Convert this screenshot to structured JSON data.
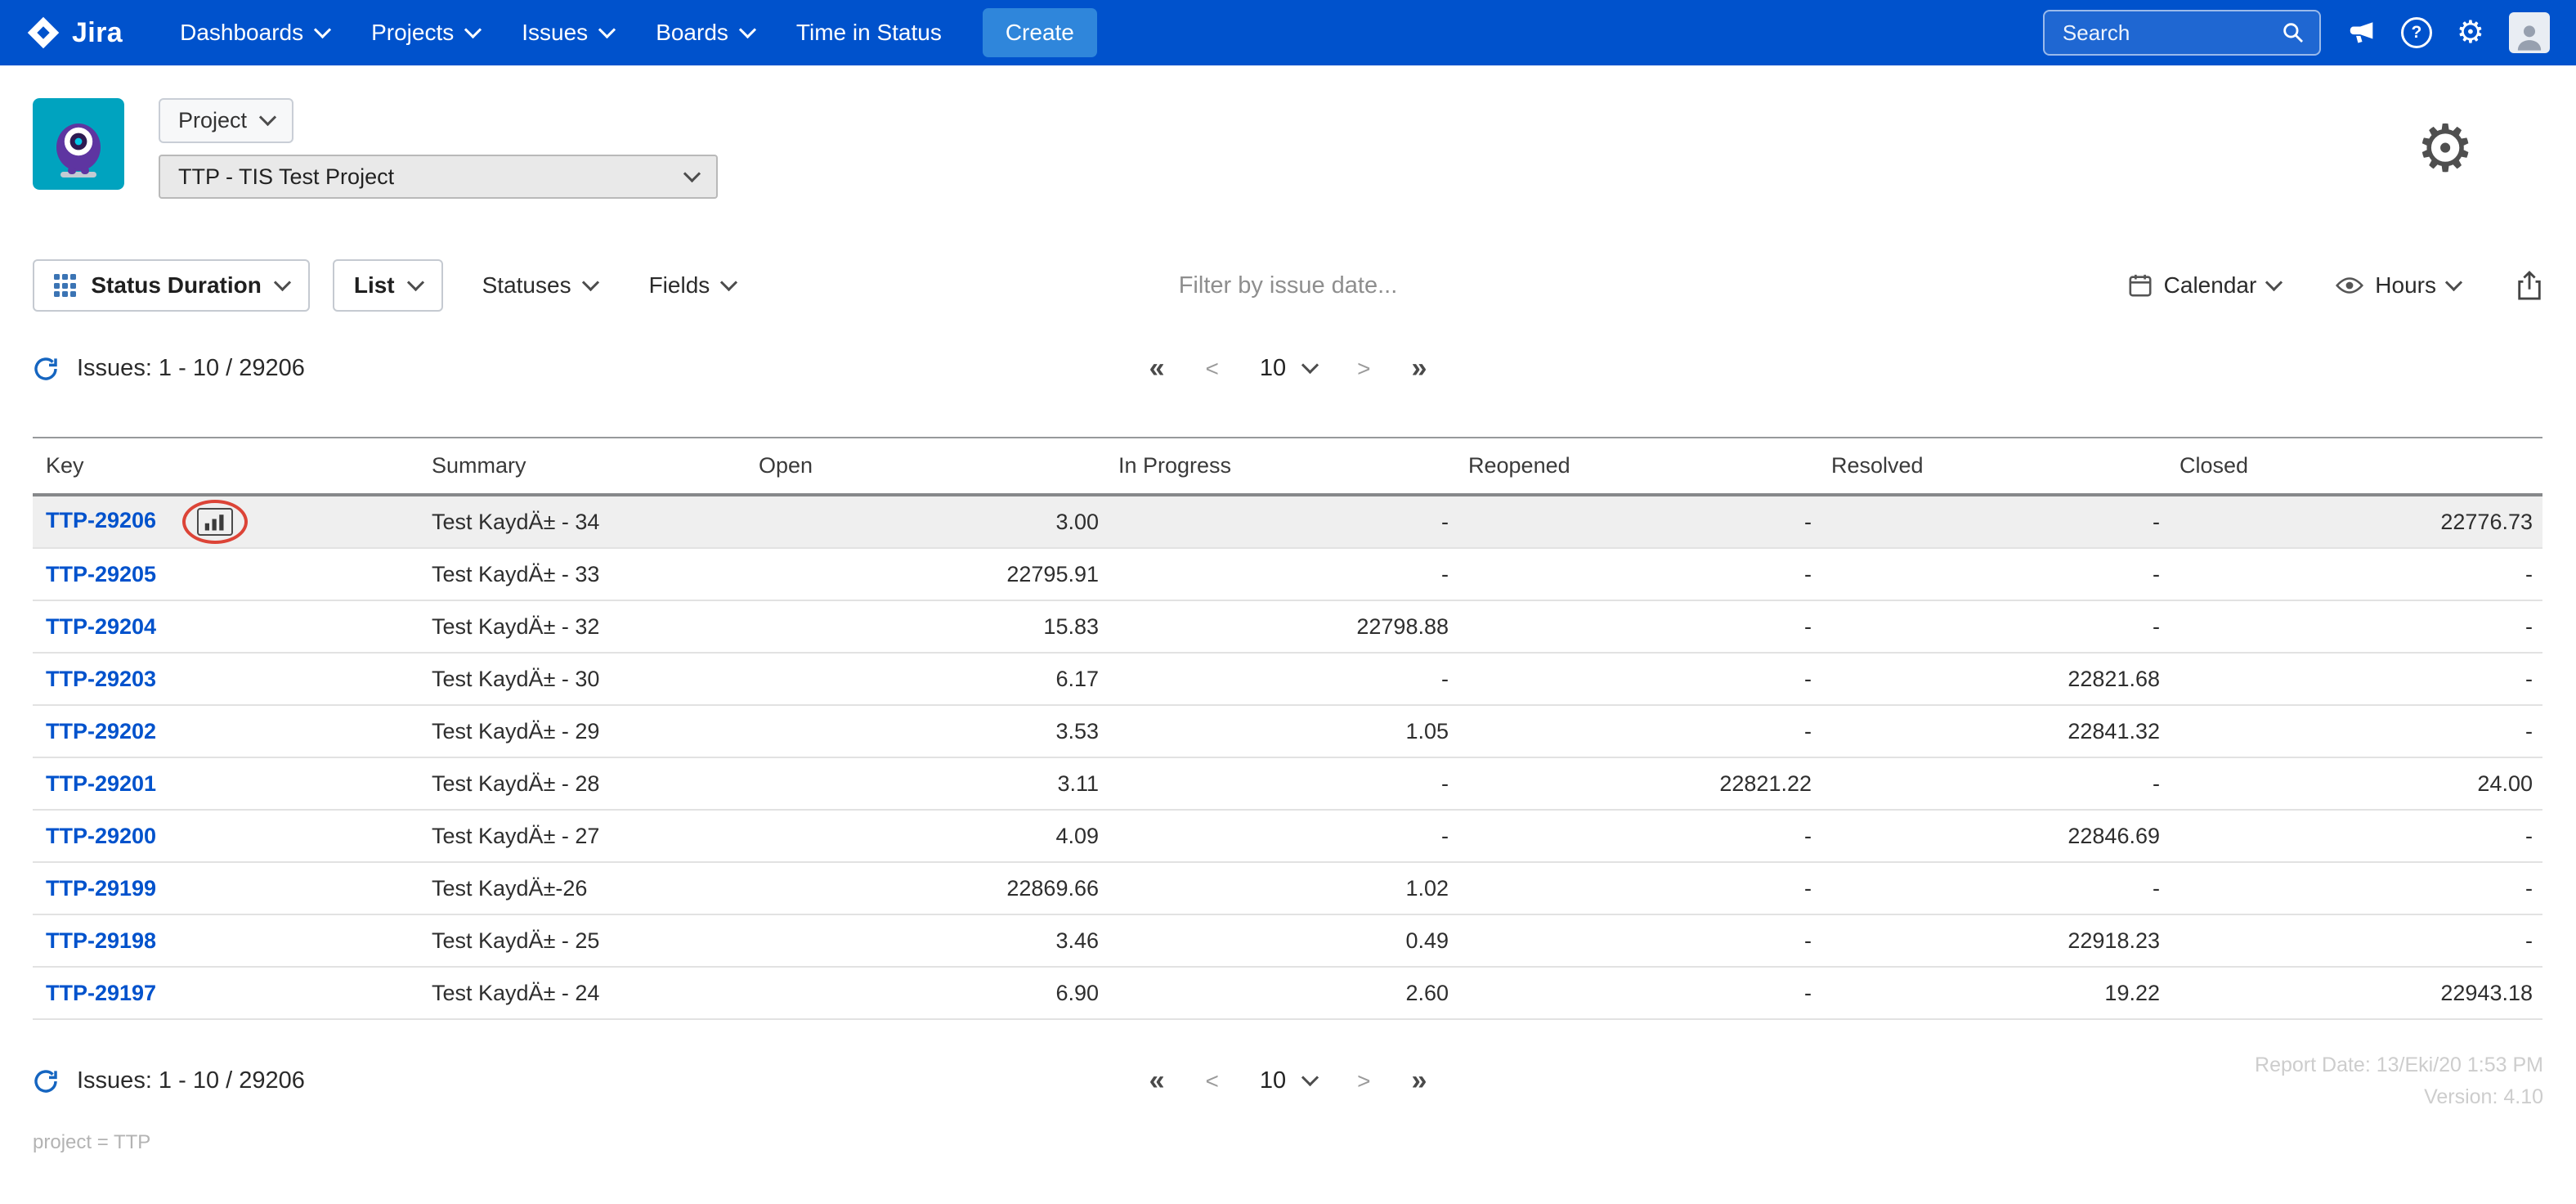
{
  "navbar": {
    "brand": "Jira",
    "items": [
      {
        "label": "Dashboards"
      },
      {
        "label": "Projects"
      },
      {
        "label": "Issues"
      },
      {
        "label": "Boards"
      },
      {
        "label": "Time in Status"
      }
    ],
    "create_label": "Create",
    "search_placeholder": "Search"
  },
  "icons": {
    "gear": "⚙",
    "help": "?"
  },
  "project_header": {
    "project_button_label": "Project",
    "project_name": "TTP - TIS Test Project"
  },
  "toolbar": {
    "report_type": "Status Duration",
    "view": "List",
    "statuses": "Statuses",
    "fields": "Fields",
    "filter_placeholder": "Filter by issue date...",
    "calendar": "Calendar",
    "time_format": "Hours"
  },
  "issues_summary": "Issues: 1 - 10 / 29206",
  "pagination": {
    "first": "«",
    "prev": "<",
    "page_size": "10",
    "next": ">",
    "last": "»"
  },
  "table": {
    "columns": [
      "Key",
      "Summary",
      "Open",
      "In Progress",
      "Reopened",
      "Resolved",
      "Closed"
    ],
    "rows": [
      {
        "key": "TTP-29206",
        "summary": "Test KaydÄ± - 34",
        "open": "3.00",
        "in_progress": "-",
        "reopened": "-",
        "resolved": "-",
        "closed": "22776.73"
      },
      {
        "key": "TTP-29205",
        "summary": "Test KaydÄ± - 33",
        "open": "22795.91",
        "in_progress": "-",
        "reopened": "-",
        "resolved": "-",
        "closed": "-"
      },
      {
        "key": "TTP-29204",
        "summary": "Test KaydÄ± - 32",
        "open": "15.83",
        "in_progress": "22798.88",
        "reopened": "-",
        "resolved": "-",
        "closed": "-"
      },
      {
        "key": "TTP-29203",
        "summary": "Test KaydÄ± - 30",
        "open": "6.17",
        "in_progress": "-",
        "reopened": "-",
        "resolved": "22821.68",
        "closed": "-"
      },
      {
        "key": "TTP-29202",
        "summary": "Test KaydÄ± - 29",
        "open": "3.53",
        "in_progress": "1.05",
        "reopened": "-",
        "resolved": "22841.32",
        "closed": "-"
      },
      {
        "key": "TTP-29201",
        "summary": "Test KaydÄ± - 28",
        "open": "3.11",
        "in_progress": "-",
        "reopened": "22821.22",
        "resolved": "-",
        "closed": "24.00"
      },
      {
        "key": "TTP-29200",
        "summary": "Test KaydÄ± - 27",
        "open": "4.09",
        "in_progress": "-",
        "reopened": "-",
        "resolved": "22846.69",
        "closed": "-"
      },
      {
        "key": "TTP-29199",
        "summary": "Test KaydÄ±-26",
        "open": "22869.66",
        "in_progress": "1.02",
        "reopened": "-",
        "resolved": "-",
        "closed": "-"
      },
      {
        "key": "TTP-29198",
        "summary": "Test KaydÄ± - 25",
        "open": "3.46",
        "in_progress": "0.49",
        "reopened": "-",
        "resolved": "22918.23",
        "closed": "-"
      },
      {
        "key": "TTP-29197",
        "summary": "Test KaydÄ± - 24",
        "open": "6.90",
        "in_progress": "2.60",
        "reopened": "-",
        "resolved": "19.22",
        "closed": "22943.18"
      }
    ]
  },
  "footer": {
    "report_date": "Report Date: 13/Eki/20 1:53 PM",
    "version": "Version: 4.10",
    "query": "project = TTP"
  }
}
